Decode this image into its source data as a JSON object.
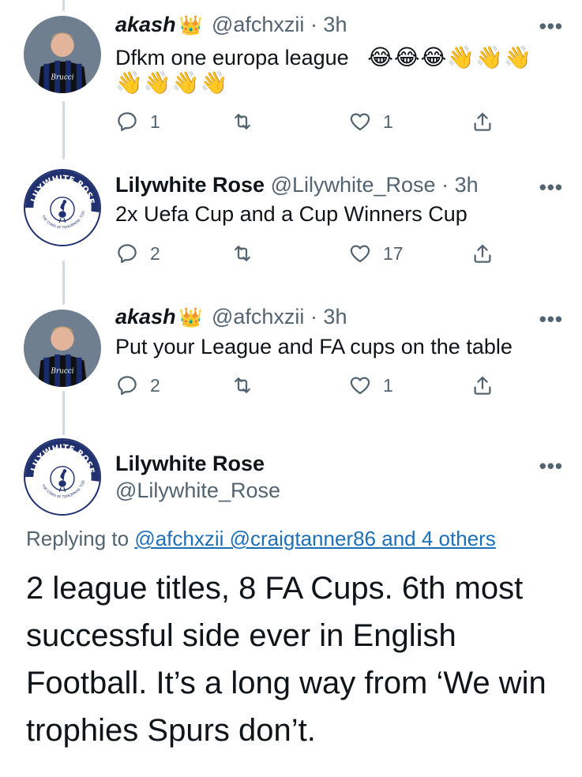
{
  "tweets": [
    {
      "name": "akash",
      "crown": "👑",
      "handle": "@afchxzii",
      "time": "· 3h",
      "text": "Dfkm one europa league",
      "emoji_line1": "😂😂😂👋👋👋",
      "emoji_line2": "👋👋👋👋",
      "replies": "1",
      "retweets": "",
      "likes": "1"
    },
    {
      "name": "Lilywhite Rose",
      "handle": "@Lilywhite_Rose",
      "time": "· 3h",
      "text": "2x Uefa Cup and a Cup Winners Cup",
      "replies": "2",
      "retweets": "",
      "likes": "17"
    },
    {
      "name": "akash",
      "crown": "👑",
      "handle": "@afchxzii",
      "time": "· 3h",
      "text": "Put your League and FA cups on the table",
      "replies": "2",
      "retweets": "",
      "likes": "1"
    }
  ],
  "main_tweet": {
    "name": "Lilywhite Rose",
    "handle": "@Lilywhite_Rose",
    "replying_prefix": "Replying to",
    "replying_links": "@afchxzii @craigtanner86 and 4 others",
    "body": "2 league titles, 8 FA Cups. 6th most successful side ever in English Football. It’s a long way from ‘We win trophies Spurs don’t."
  },
  "more_icon": "•••",
  "avatar_rose": {
    "ring_text": "LILYWHITE ROSE",
    "ring_subtext": "THE STARS OF TOMORROW, TODAY",
    "colors": {
      "ring": "#213170",
      "text": "#ffffff"
    }
  },
  "avatar_akash": {
    "shirt_text": "Brucci",
    "colors": {
      "stripe1": "#1a2b6b",
      "stripe2": "#101010",
      "bg": "#6f7f8f"
    }
  }
}
